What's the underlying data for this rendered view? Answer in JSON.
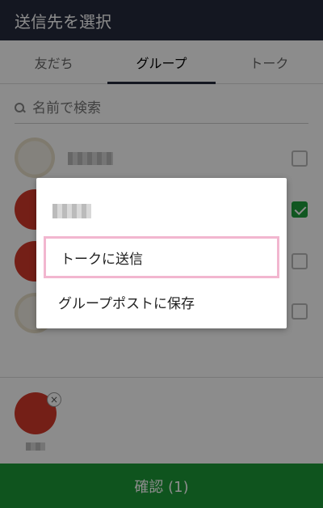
{
  "header": {
    "title": "送信先を選択"
  },
  "tabs": [
    {
      "label": "友だち",
      "active": false
    },
    {
      "label": "グループ",
      "active": true
    },
    {
      "label": "トーク",
      "active": false
    }
  ],
  "search": {
    "placeholder": "名前で検索"
  },
  "groups": [
    {
      "avatar": "pizza",
      "checked": false
    },
    {
      "avatar": "red",
      "checked": true
    },
    {
      "avatar": "red",
      "checked": false
    },
    {
      "avatar": "pizza",
      "checked": false
    }
  ],
  "dialog": {
    "options": [
      {
        "label": "トークに送信"
      },
      {
        "label": "グループポストに保存"
      }
    ]
  },
  "selected": {
    "remove_glyph": "×"
  },
  "confirm": {
    "label": "確認 (1)"
  },
  "colors": {
    "header": "#262a3d",
    "accent_green": "#1d9a37",
    "highlight": "#f2b6cf"
  }
}
